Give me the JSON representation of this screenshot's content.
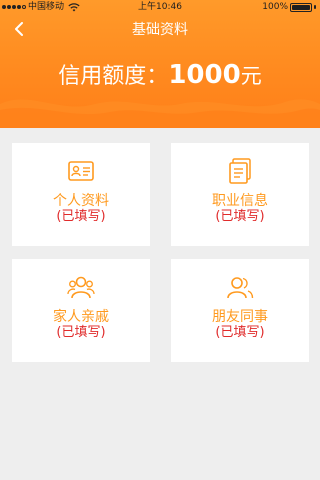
{
  "statusbar": {
    "carrier": "中国移动",
    "time": "上午10:46",
    "battery": "100%"
  },
  "nav": {
    "title": "基础资料",
    "back_icon": "chevron-left-icon"
  },
  "credit": {
    "label": "信用额度：",
    "amount": "1000",
    "unit": "元"
  },
  "cards": [
    {
      "title": "个人资料",
      "status": "(已填写)",
      "icon": "id-card-icon"
    },
    {
      "title": "职业信息",
      "status": "(已填写)",
      "icon": "document-icon"
    },
    {
      "title": "家人亲戚",
      "status": "(已填写)",
      "icon": "family-icon"
    },
    {
      "title": "朋友同事",
      "status": "(已填写)",
      "icon": "friends-icon"
    }
  ],
  "colors": {
    "header_orange": "#ff8a1f",
    "card_title": "#ff9a1f",
    "status_red": "#e02b2b",
    "background": "#eeeeee"
  }
}
